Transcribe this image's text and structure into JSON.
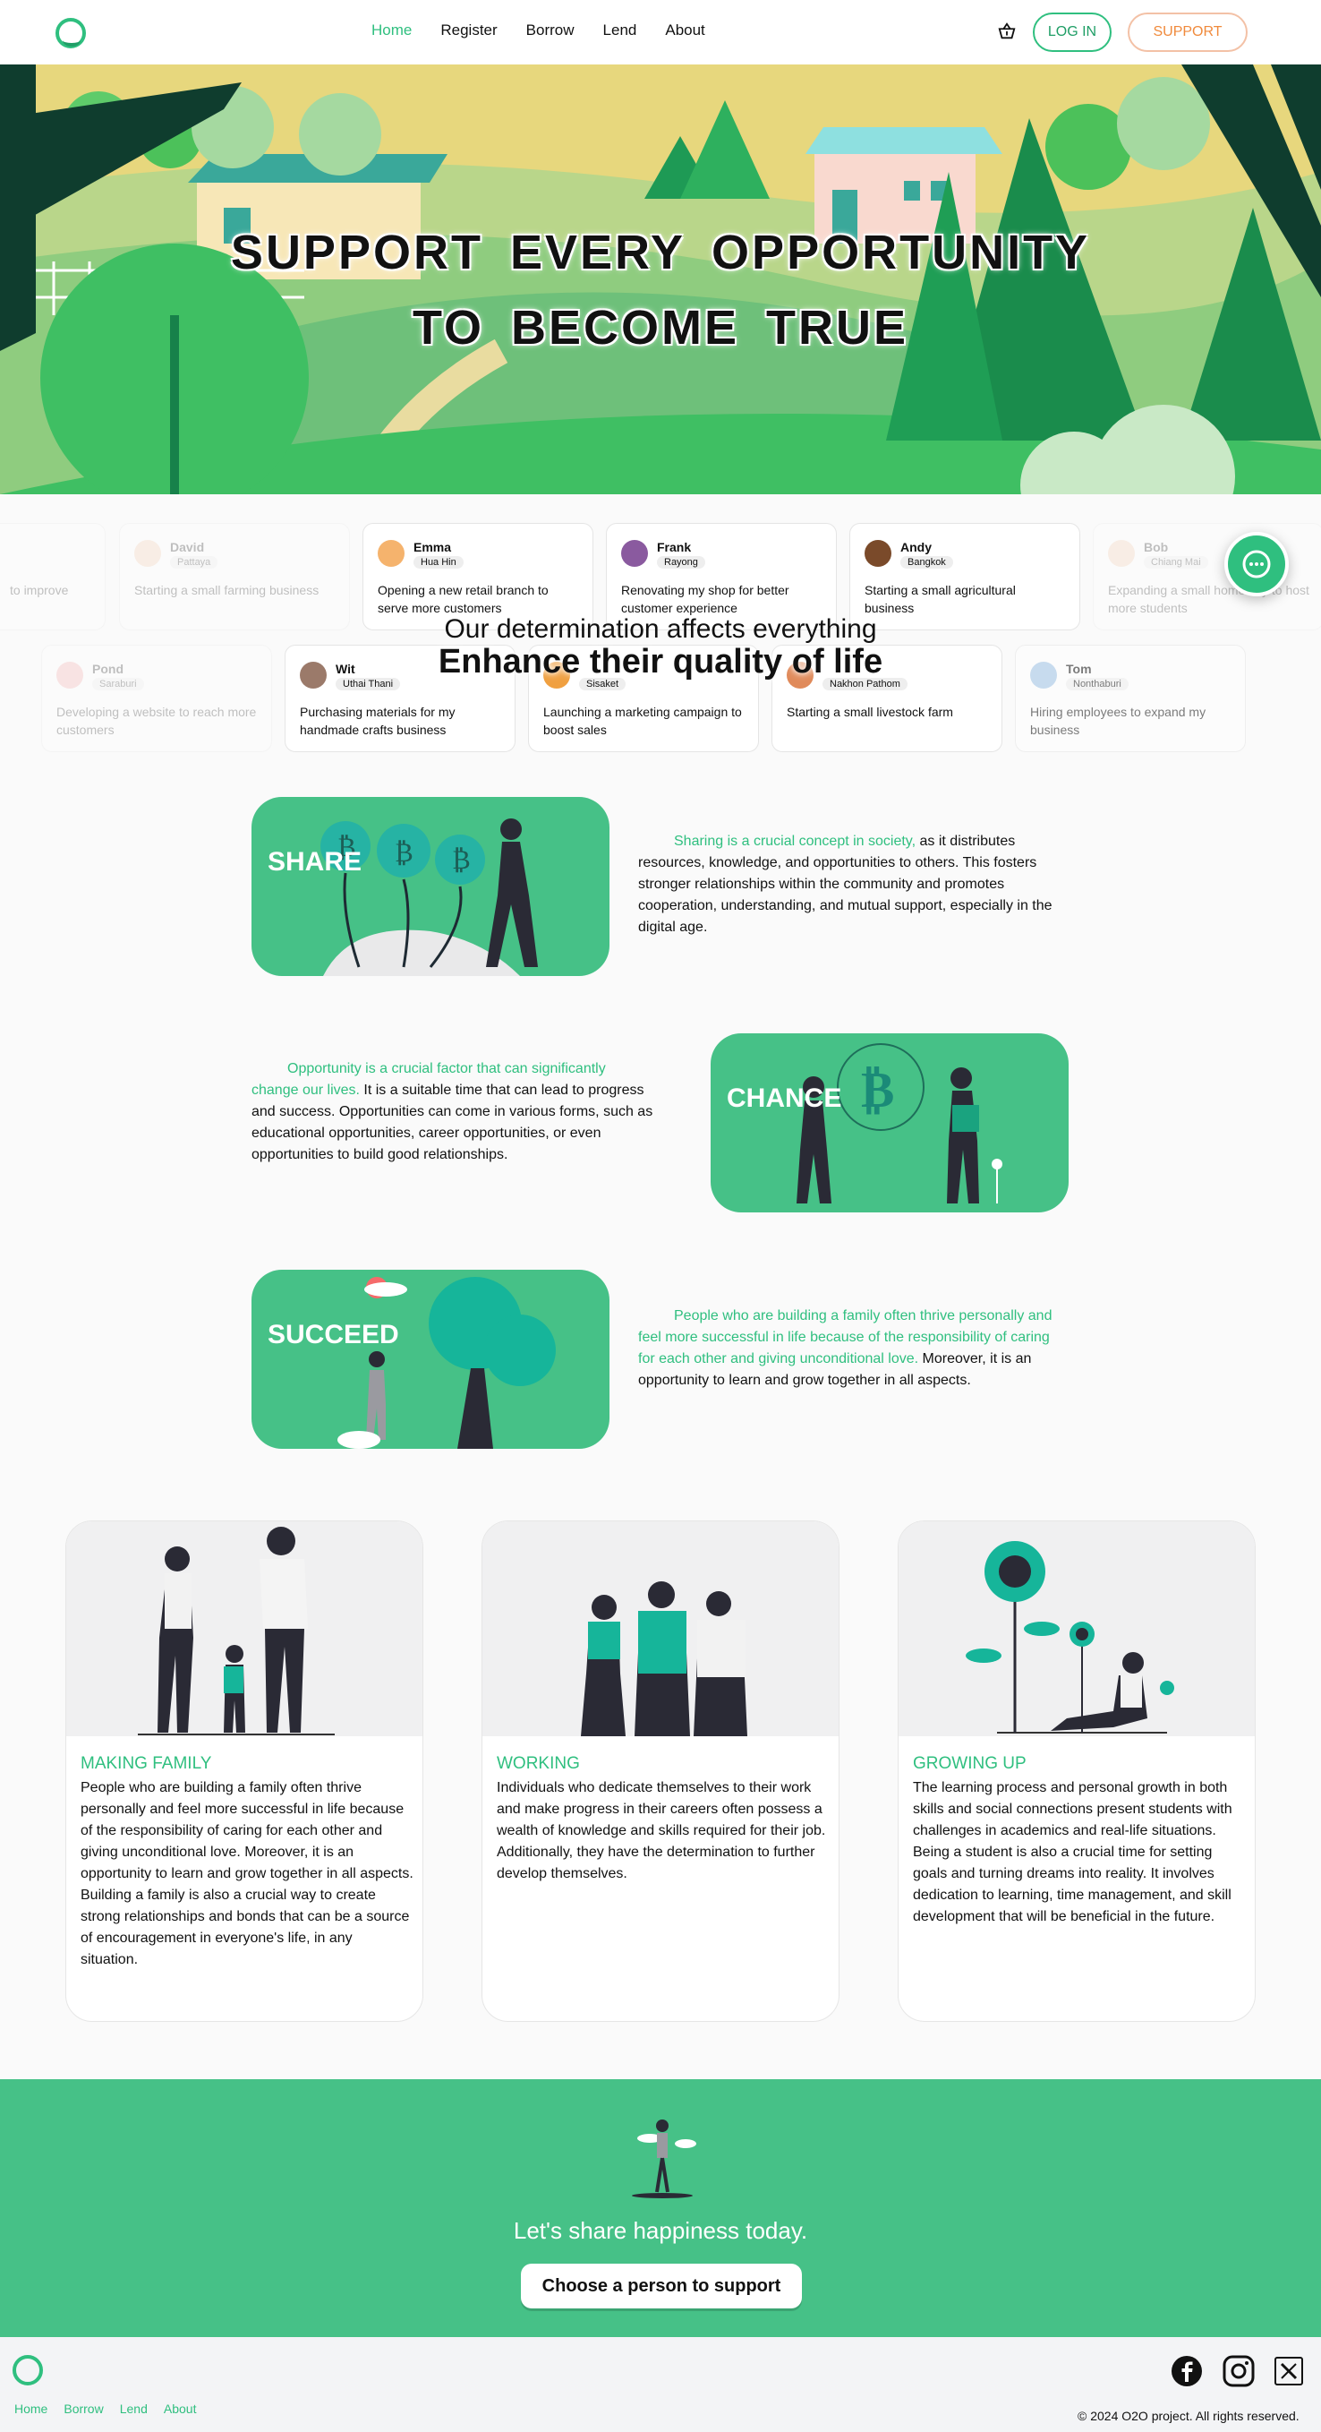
{
  "nav": {
    "menu": [
      "Home",
      "Register",
      "Borrow",
      "Lend",
      "About"
    ],
    "login": "LOG IN",
    "support": "SUPPORT"
  },
  "hero": {
    "line1": "SUPPORT EVERY OPPORTUNITY",
    "line2": "TO BECOME TRUE"
  },
  "people_row1": [
    {
      "name": "",
      "loc": "",
      "desc": "to improve"
    },
    {
      "name": "David",
      "loc": "Pattaya",
      "desc": "Starting a small farming business"
    },
    {
      "name": "Emma",
      "loc": "Hua Hin",
      "desc": "Opening a new retail branch to serve more customers"
    },
    {
      "name": "Frank",
      "loc": "Rayong",
      "desc": "Renovating my shop for better customer experience"
    },
    {
      "name": "Andy",
      "loc": "Bangkok",
      "desc": "Starting a small agricultural business"
    },
    {
      "name": "Bob",
      "loc": "Chiang Mai",
      "desc": "Expanding a small homestay to host more students"
    }
  ],
  "people_row2": [
    {
      "name": "Pond",
      "loc": "Saraburi",
      "desc": "Developing a website to reach more customers"
    },
    {
      "name": "Wit",
      "loc": "Uthai Thani",
      "desc": "Purchasing materials for my handmade crafts business"
    },
    {
      "name": "",
      "loc": "Sisaket",
      "desc": "Launching a marketing campaign to boost sales"
    },
    {
      "name": "",
      "loc": "Nakhon Pathom",
      "desc": "Starting a small livestock farm"
    },
    {
      "name": "Tom",
      "loc": "Nonthaburi",
      "desc": "Hiring employees to expand my business"
    }
  ],
  "determination": {
    "line1": "Our determination affects everything",
    "line2": "Enhance their quality of life"
  },
  "features": [
    {
      "label": "SHARE",
      "highlight": "Sharing is a crucial concept in society,",
      "text": " as it distributes resources, knowledge, and opportunities to others. This fosters stronger relationships within the community and promotes cooperation, understanding, and mutual support, especially in the digital age."
    },
    {
      "label": "CHANCE",
      "highlight": "Opportunity is a crucial factor that can significantly change our lives.",
      "text": " It is a suitable time that can lead to progress and success. Opportunities can come in various forms, such as educational opportunities, career opportunities, or even opportunities to build good relationships."
    },
    {
      "label": "SUCCEED",
      "highlight": "People who are building a family often thrive personally and feel more successful in life because of the responsibility of caring for each other and giving unconditional love.",
      "text": " Moreover, it is an opportunity to learn and grow together in all aspects."
    }
  ],
  "cards": [
    {
      "title": "MAKING FAMILY",
      "desc": "People who are building a family often thrive personally and feel more successful in life because of the responsibility of caring for each other and giving unconditional love. Moreover, it is an opportunity to learn and grow together in all aspects. Building a family is also a crucial way to create strong relationships and bonds that can be a source of encouragement in everyone's life, in any situation."
    },
    {
      "title": "WORKING",
      "desc": "Individuals who dedicate themselves to their work and make progress in their careers often possess a wealth of knowledge and skills required for their job. Additionally, they have the determination to further develop themselves."
    },
    {
      "title": "GROWING UP",
      "desc": "The learning process and personal growth in both skills and social connections present students with challenges in academics and real-life situations. Being a student is also a crucial time for setting goals and turning dreams into reality. It involves dedication to learning, time management, and skill development that will be beneficial in the future."
    }
  ],
  "cta": {
    "text": "Let's share happiness today.",
    "button": "Choose a person to support"
  },
  "footer": {
    "links": [
      "Home",
      "Borrow",
      "Lend",
      "About"
    ],
    "copyright": "© 2024 O2O project. All rights reserved."
  },
  "colors": {
    "accent": "#2fbf7f",
    "panel": "#46c187",
    "support": "#f08a3c"
  }
}
